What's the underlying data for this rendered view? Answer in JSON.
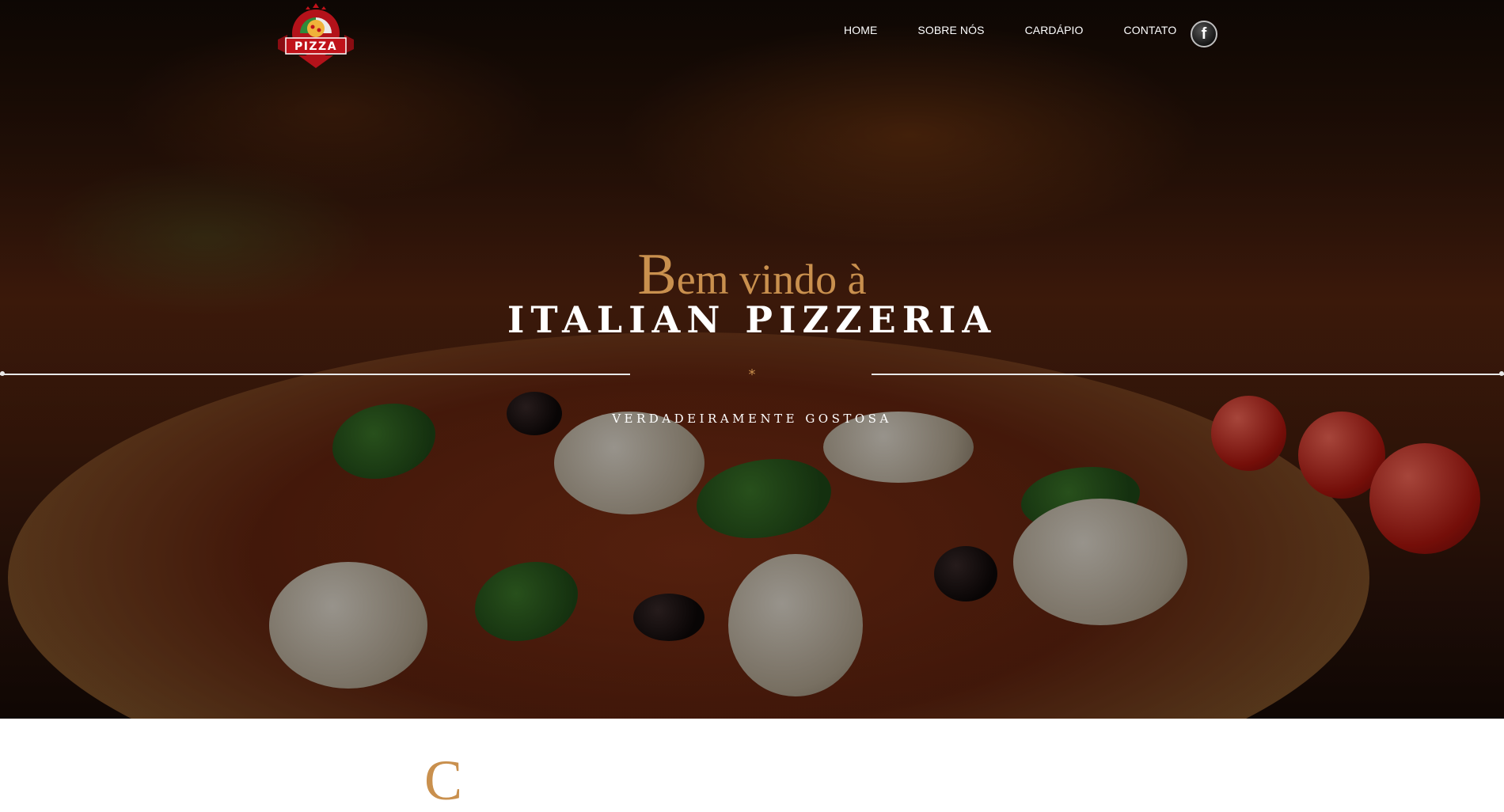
{
  "header": {
    "logo_text": "PIZZA",
    "nav": [
      {
        "label": "HOME"
      },
      {
        "label": "SOBRE NÓS"
      },
      {
        "label": "CARDÁPIO"
      },
      {
        "label": "CONTATO"
      }
    ],
    "social_icon": "facebook-icon"
  },
  "hero": {
    "welcome_initial": "B",
    "welcome_rest": "em vindo à",
    "brand": "ITALIAN PIZZERIA",
    "divider_glyph": "*",
    "tagline": "VERDADEIRAMENTE GOSTOSA"
  },
  "next_section": {
    "heading_fragment": "C"
  },
  "colors": {
    "accent_gold": "#c9904e",
    "text_white": "#ffffff",
    "logo_red": "#b3121a"
  }
}
